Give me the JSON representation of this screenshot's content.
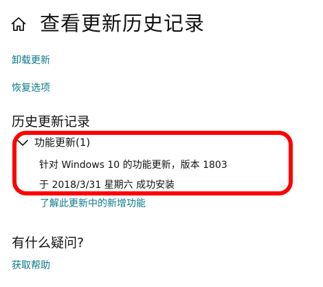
{
  "header": {
    "title": "查看更新历史记录",
    "home_icon": "home-icon"
  },
  "links": {
    "uninstall": "卸载更新",
    "recovery": "恢复选项"
  },
  "history": {
    "section_title": "历史更新记录",
    "group": {
      "label": "功能更新(1)",
      "expanded": true,
      "items": [
        {
          "name": "针对 Windows 10 的功能更新，版本 1803",
          "status": "于 2018/3/31 星期六 成功安装",
          "link": "了解此更新中的新增功能"
        }
      ]
    }
  },
  "help": {
    "section_title": "有什么疑问?",
    "link": "获取帮助"
  },
  "colors": {
    "link": "#0a7a8a",
    "text": "#111111",
    "annotation": "#ff0000",
    "background": "#ffffff"
  }
}
